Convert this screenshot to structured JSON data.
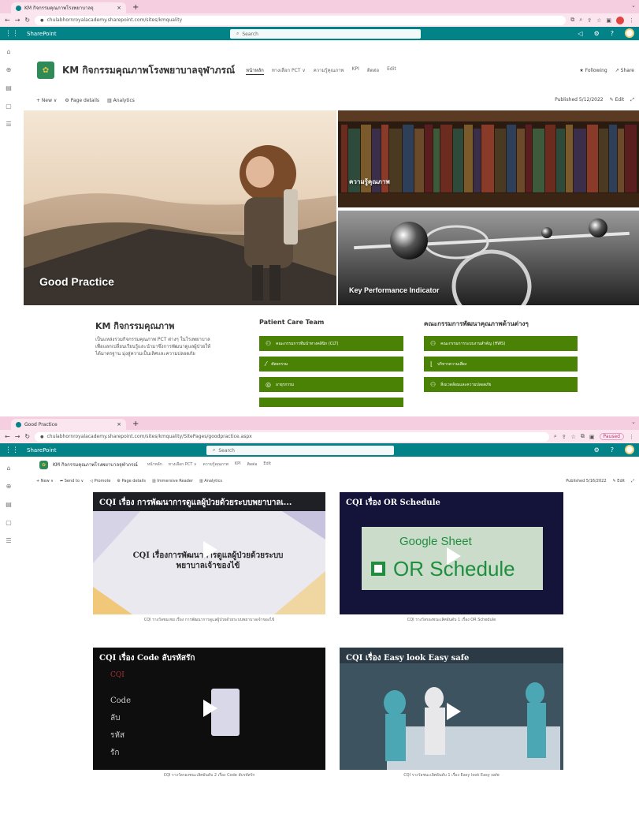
{
  "shot1": {
    "tab_title": "KM กิจกรรมคุณภาพโรงพยาบาลจุ",
    "new_tab": "+",
    "url": "chulabhornroyalacademy.sharepoint.com/sites/kmquality",
    "app_name": "SharePoint",
    "search_placeholder": "Search",
    "site_title": "KM กิจกรรมคุณภาพโรงพยาบาลจุฬาภรณ์",
    "nav": [
      "หน้าหลัก",
      "ทางเลือก PCT ∨",
      "ความรู้คุณภาพ",
      "KPI",
      "ติดต่อ",
      "Edit"
    ],
    "following": "★ Following",
    "share": "↗ Share",
    "cmd": {
      "new": "+ New ∨",
      "page_details": "Page details",
      "analytics": "Analytics"
    },
    "published": "Published 5/12/2022",
    "edit": "Edit",
    "hero": {
      "left": "Good Practice",
      "right_top": "ความรู้คุณภาพ",
      "right_bottom": "Key Performance Indicator"
    },
    "km": {
      "title": "KM กิจกรรมคุณภาพ",
      "desc": "เป็นแหล่งรวมกิจกรรมคุณภาพ PCT ต่างๆ ในโรงพยาบาล เพื่อแลกเปลี่ยนเรียนรู้และนำมาซึ่งการพัฒนาดูแลผู้ป่วยให้ได้มาตรฐาน มุ่งสู่ความเป็นเลิศและความปลอดภัย"
    },
    "pct": {
      "title": "Patient Care Team",
      "buttons": [
        "คณะกรรมการทีมนำทางคลินิก (CLT)",
        "ศัลยกรรม",
        "อายุรกรรม",
        ""
      ]
    },
    "committee": {
      "title": "คณะกรรมการพัฒนาคุณภาพด้านต่างๆ",
      "buttons": [
        "คณะกรรมการระบบงานสำคัญ (HWS)",
        "บริหารความเสี่ยง",
        "สิ่งแวดล้อมและความปลอดภัย"
      ]
    }
  },
  "shot2": {
    "tab_title": "Good Practice",
    "url": "chulabhornroyalacademy.sharepoint.com/sites/kmquality/SitePages/goodpractice.aspx",
    "paused": "Paused",
    "app_name": "SharePoint",
    "search_placeholder": "Search",
    "site_title": "KM กิจกรรมคุณภาพโรงพยาบาลจุฬาภรณ์",
    "nav": [
      "หน้าหลัก",
      "ทางเลือก PCT ∨",
      "ความรู้คุณภาพ",
      "KPI",
      "ติดต่อ",
      "Edit"
    ],
    "cmd": {
      "new": "+ New ∨",
      "send_to": "Send to ∨",
      "promote": "Promote",
      "page_details": "Page details",
      "immersive": "Immersive Reader",
      "analytics": "Analytics"
    },
    "published": "Published 5/16/2022",
    "edit": "Edit",
    "videos": [
      {
        "title": "CQI เรื่อง การพัฒนาการดูแลผู้ป่วยด้วยระบบพยาบาลเ...",
        "inner": "CQI เรื่องการพัฒนาการดูแลผู้ป่วยด้วยระบบพยาบาลเจ้าของไข้",
        "caption": "CQI รางวัลชมเชย เรื่อง การพัฒนาการดูแลผู้ป่วยด้วยระบบพยาบาลเจ้าของไข้"
      },
      {
        "title": "CQI เรื่อง OR Schedule",
        "inner_top": "Google Sheet",
        "inner": "OR Schedule",
        "caption": "CQI รางวัลรองชนะเลิศอันดับ 1 เรื่อง OR Schedule"
      },
      {
        "title": "CQI เรื่อง Code ลับรหัสรัก",
        "inner_lines": [
          "CQI",
          "Code",
          "ลับ",
          "รหัส",
          "รัก"
        ],
        "caption": "CQI รางวัลรองชนะเลิศอันดับ 2 เรื่อง Code ลับรหัสรัก"
      },
      {
        "title": "CQI เรื่อง Easy look Easy safe",
        "caption": "CQI รางวัลชนะเลิศอันดับ 1 เรื่อง Easy look Easy safe"
      }
    ]
  }
}
